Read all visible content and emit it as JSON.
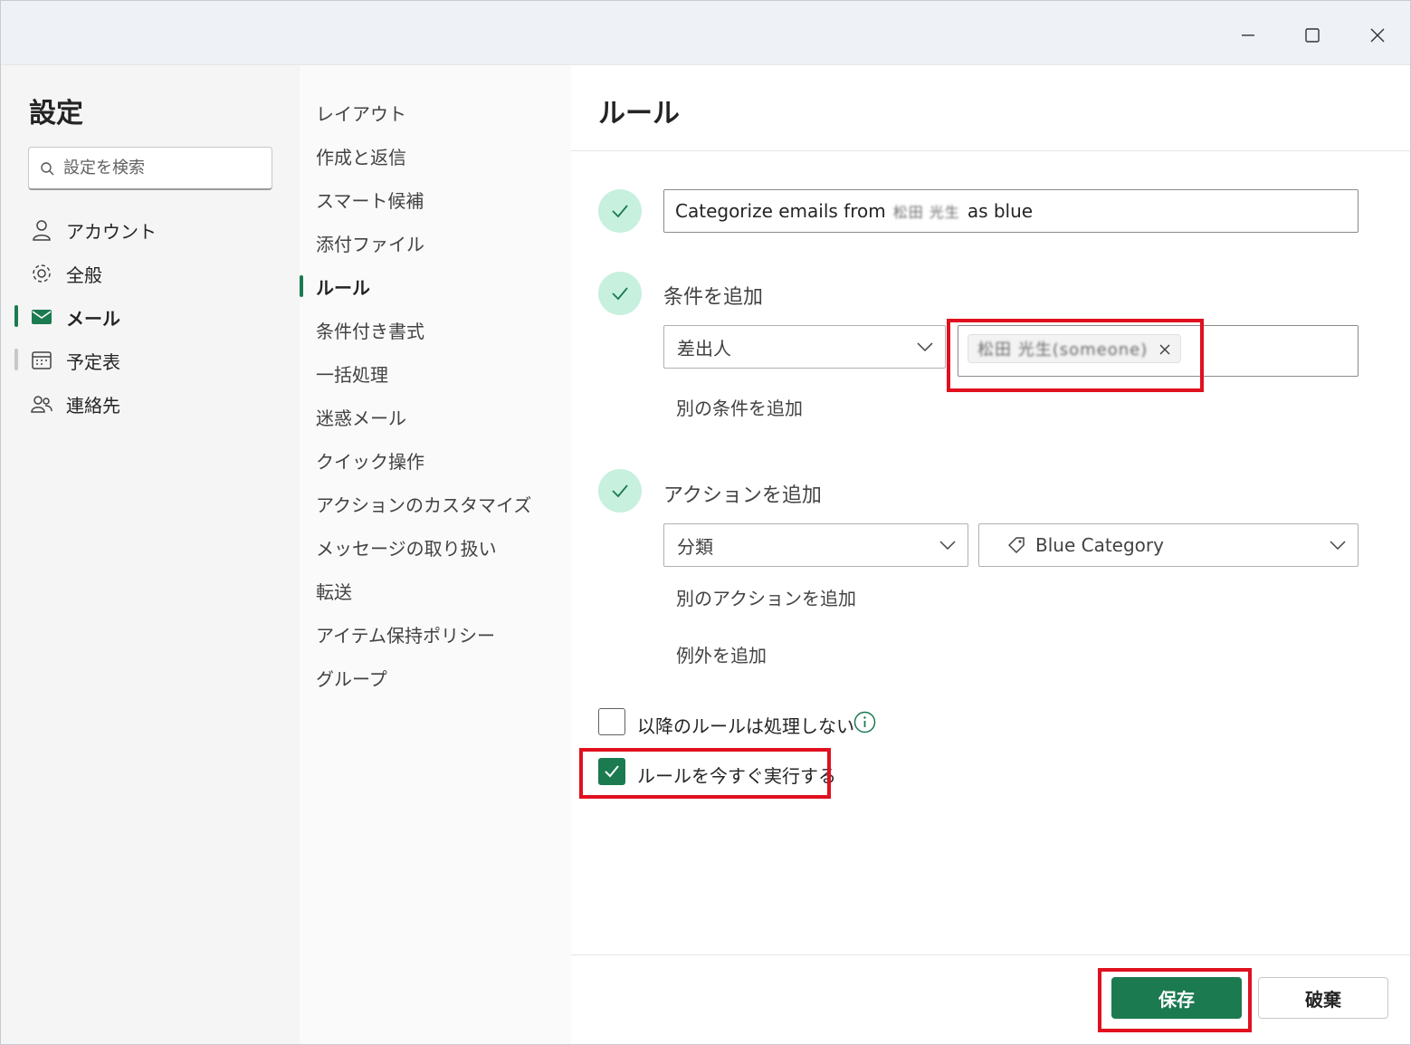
{
  "settings": {
    "title": "設定",
    "search_placeholder": "設定を検索",
    "nav": [
      {
        "label": "アカウント",
        "icon": "person-icon"
      },
      {
        "label": "全般",
        "icon": "gear-icon"
      },
      {
        "label": "メール",
        "icon": "mail-icon",
        "active": true
      },
      {
        "label": "予定表",
        "icon": "calendar-icon"
      },
      {
        "label": "連絡先",
        "icon": "people-icon"
      }
    ]
  },
  "submenu": {
    "items": [
      "レイアウト",
      "作成と返信",
      "スマート候補",
      "添付ファイル",
      "ルール",
      "条件付き書式",
      "一括処理",
      "迷惑メール",
      "クイック操作",
      "アクションのカスタマイズ",
      "メッセージの取り扱い",
      "転送",
      "アイテム保持ポリシー",
      "グループ"
    ],
    "active_index": 4
  },
  "rule": {
    "title": "ルール",
    "name_prefix": "Categorize emails from",
    "name_redacted": "松田 光生",
    "name_suffix": "as blue",
    "condition_label": "条件を追加",
    "condition_field": "差出人",
    "condition_value_redacted": "松田 光生(someone)",
    "add_condition": "別の条件を追加",
    "action_label": "アクションを追加",
    "action_field": "分類",
    "action_value": "Blue Category",
    "add_action": "別のアクションを追加",
    "add_exception": "例外を追加",
    "stop_processing_label": "以降のルールは処理しない",
    "stop_processing_checked": false,
    "run_now_label": "ルールを今すぐ実行する",
    "run_now_checked": true,
    "save_label": "保存",
    "discard_label": "破棄"
  },
  "colors": {
    "accent": "#1b7a50",
    "highlight": "#e0101e",
    "step_bg": "#c7f0de"
  }
}
